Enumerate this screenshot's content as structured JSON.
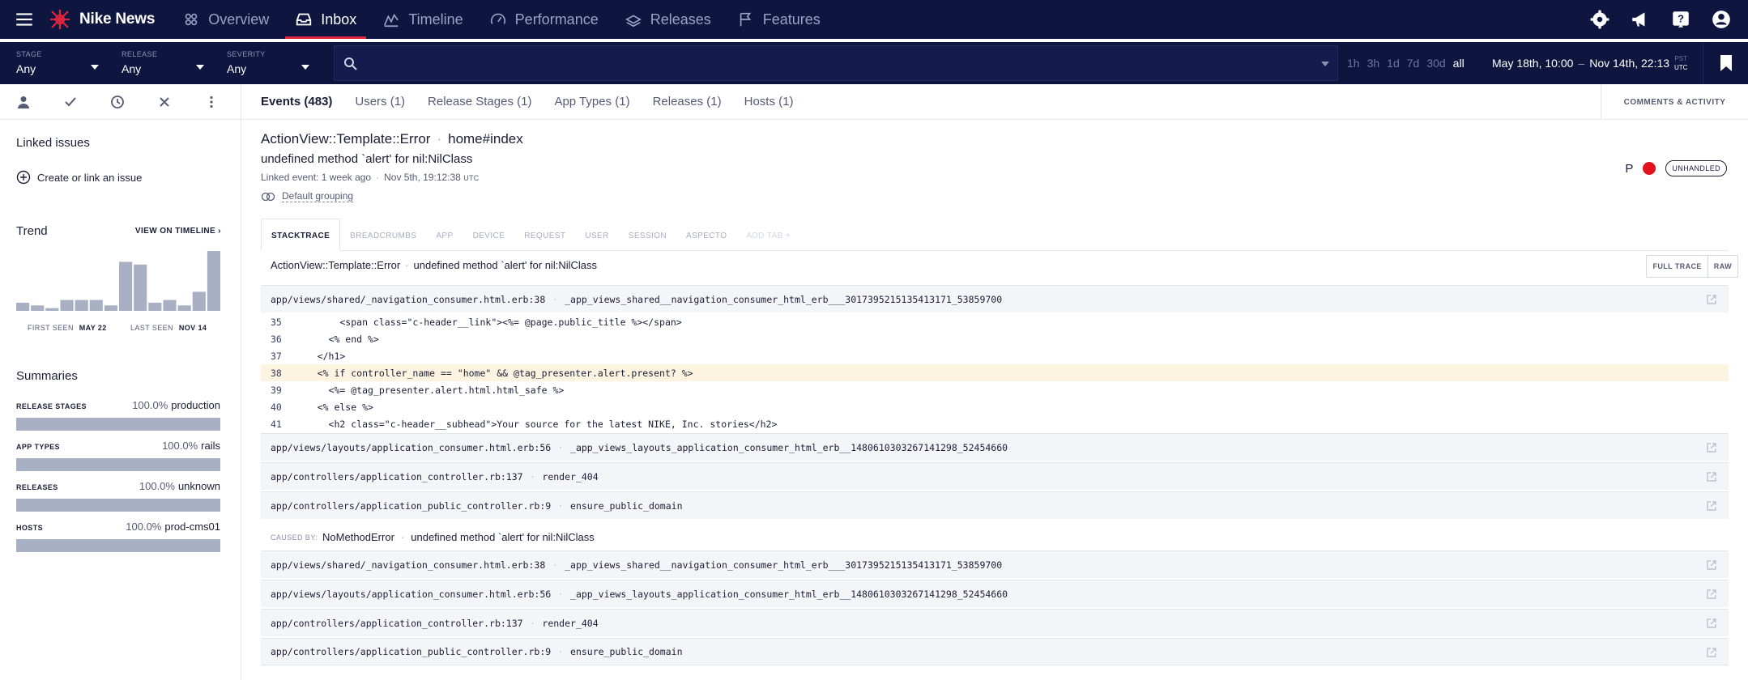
{
  "nav": {
    "brand": "Nike News",
    "items": [
      {
        "label": "Overview"
      },
      {
        "label": "Inbox"
      },
      {
        "label": "Timeline"
      },
      {
        "label": "Performance"
      },
      {
        "label": "Releases"
      },
      {
        "label": "Features"
      }
    ],
    "active": "Inbox"
  },
  "filters": {
    "stage": {
      "label": "STAGE",
      "value": "Any"
    },
    "release": {
      "label": "RELEASE",
      "value": "Any"
    },
    "severity": {
      "label": "SEVERITY",
      "value": "Any"
    },
    "search_value": "",
    "ranges": [
      "1h",
      "3h",
      "1d",
      "7d",
      "30d",
      "all"
    ],
    "active_range": "all",
    "date_from": "May 18th, 10:00",
    "date_sep": "–",
    "date_to": "Nov 14th, 22:13",
    "tz_pst": "PST",
    "tz_utc": "UTC"
  },
  "sidebar": {
    "linked_heading": "Linked issues",
    "create_link": "Create or link an issue",
    "trend_heading": "Trend",
    "view_timeline": "VIEW ON TIMELINE ›",
    "trend_values": [
      3,
      2,
      1,
      4,
      4,
      4,
      2,
      18,
      17,
      3,
      4,
      2,
      7,
      22
    ],
    "first_seen_label": "FIRST SEEN",
    "first_seen_value": "MAY 22",
    "last_seen_label": "LAST SEEN",
    "last_seen_value": "NOV 14",
    "summaries_heading": "Summaries",
    "summaries": [
      {
        "key": "RELEASE STAGES",
        "pct": "100.0%",
        "value": "production"
      },
      {
        "key": "APP TYPES",
        "pct": "100.0%",
        "value": "rails"
      },
      {
        "key": "RELEASES",
        "pct": "100.0%",
        "value": "unknown"
      },
      {
        "key": "HOSTS",
        "pct": "100.0%",
        "value": "prod-cms01"
      }
    ]
  },
  "tabs": [
    {
      "label": "Events (483)"
    },
    {
      "label": "Users (1)"
    },
    {
      "label": "Release Stages (1)"
    },
    {
      "label": "App Types (1)"
    },
    {
      "label": "Releases (1)"
    },
    {
      "label": "Hosts (1)"
    }
  ],
  "comments_label": "COMMENTS & ACTIVITY",
  "error": {
    "class": "ActionView::Template::Error",
    "context": "home#index",
    "message": "undefined method `alert' for nil:NilClass",
    "linked_event": "Linked event: 1 week ago",
    "timestamp": "Nov 5th, 19:12:38",
    "timestamp_tz": "UTC",
    "grouping": "Default grouping",
    "severity_letter": "P",
    "handled": "UNHANDLED",
    "severity_color": "#e4111e"
  },
  "subtabs": [
    "STACKTRACE",
    "BREADCRUMBS",
    "APP",
    "DEVICE",
    "REQUEST",
    "USER",
    "SESSION",
    "ASPECTO",
    "ADD TAB +"
  ],
  "exception_line": {
    "class": "ActionView::Template::Error",
    "message": "undefined method `alert' for nil:NilClass"
  },
  "trace_buttons": {
    "full": "FULL TRACE",
    "raw": "RAW"
  },
  "frames_top": [
    {
      "file": "app/views/shared/_navigation_consumer.html.erb:38",
      "method": "_app_views_shared__navigation_consumer_html_erb___3017395215135413171_53859700"
    },
    {
      "file": "app/views/layouts/application_consumer.html.erb:56",
      "method": "_app_views_layouts_application_consumer_html_erb__1480610303267141298_52454660"
    },
    {
      "file": "app/controllers/application_controller.rb:137",
      "method": "render_404"
    },
    {
      "file": "app/controllers/application_public_controller.rb:9",
      "method": "ensure_public_domain"
    }
  ],
  "code_lines": [
    {
      "n": "35",
      "text": "        <span class=\"c-header__link\"><%= @page.public_title %></span>"
    },
    {
      "n": "36",
      "text": "      <% end %>"
    },
    {
      "n": "37",
      "text": "    </h1>"
    },
    {
      "n": "38",
      "text": "    <% if controller_name == \"home\" && @tag_presenter.alert.present? %>"
    },
    {
      "n": "39",
      "text": "      <%= @tag_presenter.alert.html.html_safe %>"
    },
    {
      "n": "40",
      "text": "    <% else %>"
    },
    {
      "n": "41",
      "text": "      <h2 class=\"c-header__subhead\">Your source for the latest NIKE, Inc. stories</h2>"
    }
  ],
  "caused_by": {
    "label": "CAUSED BY:",
    "class": "NoMethodError",
    "message": "undefined method `alert' for nil:NilClass"
  },
  "frames_bottom": [
    {
      "file": "app/views/shared/_navigation_consumer.html.erb:38",
      "method": "_app_views_shared__navigation_consumer_html_erb___3017395215135413171_53859700"
    },
    {
      "file": "app/views/layouts/application_consumer.html.erb:56",
      "method": "_app_views_layouts_application_consumer_html_erb__1480610303267141298_52454660"
    },
    {
      "file": "app/controllers/application_controller.rb:137",
      "method": "render_404"
    },
    {
      "file": "app/controllers/application_public_controller.rb:9",
      "method": "ensure_public_domain"
    }
  ]
}
